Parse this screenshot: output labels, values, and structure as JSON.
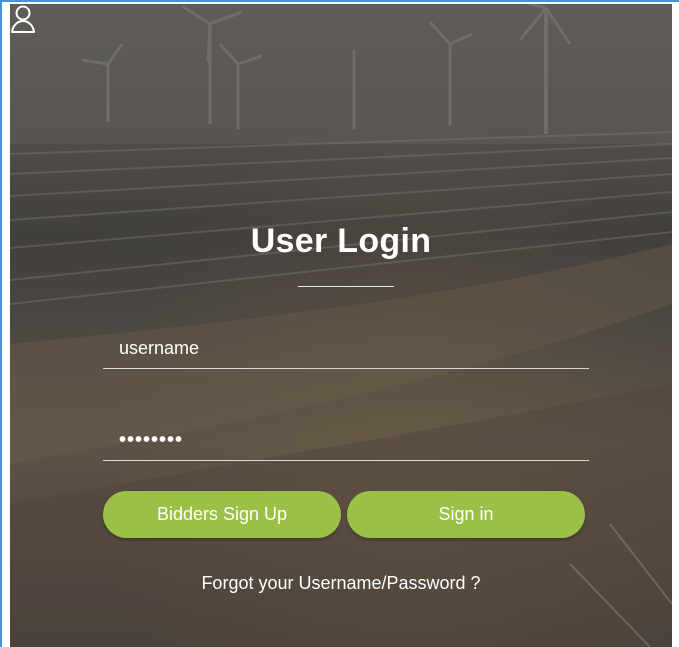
{
  "login": {
    "title": "User Login",
    "username_value": "username",
    "password_value": "••••••••",
    "signup_label": "Bidders Sign Up",
    "signin_label": "Sign in",
    "forgot_label": "Forgot your Username/Password ?",
    "user_icon": "user-icon",
    "accent_color": "#9bc048"
  }
}
